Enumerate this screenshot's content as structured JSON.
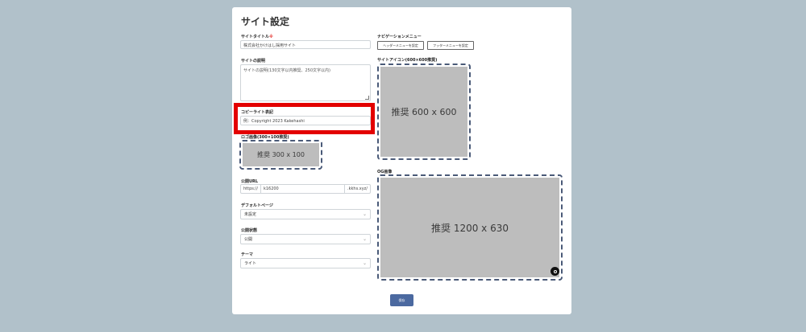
{
  "page": {
    "title": "サイト設定"
  },
  "site_title": {
    "label": "サイトタイトル",
    "required_mark": "※",
    "value": "株式会社かけはし採用サイト"
  },
  "site_description": {
    "label": "サイトの説明",
    "value": "サイトの説明(130文字以内推奨、250文字以内)"
  },
  "copyright": {
    "label": "コピーライト表記",
    "placeholder": "例：Copyright 2023 Kakehashi"
  },
  "logo_image": {
    "label": "ロゴ画像(300×100推奨)",
    "placeholder": "推奨 300 x 100"
  },
  "public_url": {
    "label": "公開URL",
    "prefix": "https://",
    "value": "k16200",
    "suffix": ".kkhs.xyz/"
  },
  "default_page": {
    "label": "デフォルトページ",
    "selected": "未設定"
  },
  "publish_status": {
    "label": "公開状態",
    "selected": "公開"
  },
  "theme": {
    "label": "テーマ",
    "selected": "ライト"
  },
  "navigation": {
    "label": "ナビゲーションメニュー",
    "header_button": "ヘッダーメニューを設定",
    "footer_button": "フッターメニューを設定"
  },
  "site_icon": {
    "label": "サイトアイコン(600×600推奨)",
    "placeholder": "推奨 600 x 600"
  },
  "og_image": {
    "label": "OG画像",
    "placeholder": "推奨 1200 x 630"
  },
  "actions": {
    "save_label": "保存"
  },
  "colors": {
    "background": "#b1c1ca",
    "highlight": "#e30000",
    "primary": "#4b69a0",
    "required": "#e53935"
  }
}
